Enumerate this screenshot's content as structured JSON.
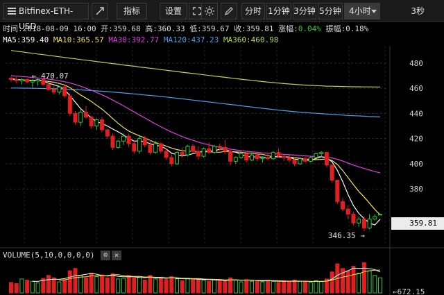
{
  "toolbar": {
    "symbol": "Bitfinex-ETH-USD",
    "indicators": "指标",
    "settings": "设置",
    "intervals": [
      "分时",
      "1分钟",
      "3分钟",
      "5分钟",
      "4小时"
    ],
    "active_interval": "4小时",
    "refresh": "3秒"
  },
  "info": {
    "time": "时间:2018-08-09 16:00",
    "open": "开:359.68",
    "high": "高:360.33",
    "low": "低:359.67",
    "close": "收:359.81",
    "change_label": "涨幅:",
    "change_value": "0.04%",
    "amplitude": "振幅:0.18%"
  },
  "ma": {
    "ma5": "MA5:359.40",
    "ma10": "MA10:365.57",
    "ma30": "MA30:392.77",
    "ma120": "MA120:437.23",
    "ma360": "MA360:460.98"
  },
  "volume": {
    "label": "VOLUME(5,10,0,0,0,0)",
    "last_label": "672.15"
  },
  "colors": {
    "up": "#32c832",
    "down": "#e02020",
    "ma5": "#ffffff",
    "ma10": "#f5e05a",
    "ma30": "#e040e0",
    "ma120": "#4aa0e8",
    "ma360": "#b8d85a"
  },
  "chart_data": {
    "type": "candlestick",
    "ylim": [
      336,
      486
    ],
    "yticks": [
      380,
      400,
      420,
      440,
      460,
      480
    ],
    "annotations": {
      "high": "470.07",
      "low": "346.35"
    },
    "last_price": "359.81",
    "candles": [
      [
        468,
        469.5,
        465,
        467
      ],
      [
        467,
        470.07,
        464,
        466
      ],
      [
        466,
        468,
        463,
        467
      ],
      [
        467,
        468,
        464,
        465
      ],
      [
        465,
        467,
        461,
        466
      ],
      [
        466,
        468,
        462,
        467
      ],
      [
        467,
        468,
        462,
        463
      ],
      [
        463,
        465,
        458,
        459
      ],
      [
        459,
        462,
        455,
        457
      ],
      [
        457,
        462,
        455,
        461
      ],
      [
        461,
        462,
        452,
        454
      ],
      [
        454,
        456,
        438,
        440
      ],
      [
        440,
        442,
        431,
        433
      ],
      [
        433,
        443,
        430,
        441
      ],
      [
        441,
        446,
        436,
        437
      ],
      [
        437,
        438,
        428,
        430
      ],
      [
        430,
        436,
        427,
        435
      ],
      [
        435,
        437,
        425,
        427
      ],
      [
        427,
        428,
        420,
        422
      ],
      [
        422,
        424,
        411,
        413
      ],
      [
        413,
        419,
        412,
        418
      ],
      [
        418,
        424,
        415,
        422
      ],
      [
        422,
        424,
        413,
        416
      ],
      [
        416,
        418,
        408,
        410
      ],
      [
        410,
        422,
        408,
        420
      ],
      [
        420,
        422,
        413,
        415
      ],
      [
        415,
        419,
        407,
        409
      ],
      [
        409,
        418,
        408,
        416
      ],
      [
        416,
        417,
        408,
        410
      ],
      [
        410,
        412,
        403,
        405
      ],
      [
        405,
        408,
        398,
        400
      ],
      [
        400,
        410,
        399,
        409
      ],
      [
        409,
        413,
        405,
        407
      ],
      [
        407,
        415,
        406,
        414
      ],
      [
        414,
        416,
        408,
        410
      ],
      [
        410,
        414,
        403,
        406
      ],
      [
        406,
        413,
        405,
        412
      ],
      [
        412,
        417,
        408,
        409
      ],
      [
        409,
        415,
        408,
        414
      ],
      [
        414,
        416,
        410,
        413
      ],
      [
        413,
        419,
        408,
        410
      ],
      [
        410,
        412,
        399,
        402
      ],
      [
        402,
        406,
        400,
        405
      ],
      [
        405,
        410,
        404,
        408
      ],
      [
        408,
        410,
        401,
        403
      ],
      [
        403,
        409,
        402,
        407
      ],
      [
        407,
        409,
        402,
        404
      ],
      [
        404,
        406,
        401,
        405
      ],
      [
        405,
        408,
        403,
        404
      ],
      [
        404,
        410,
        403,
        409
      ],
      [
        409,
        412,
        405,
        406
      ],
      [
        406,
        408,
        402,
        405
      ],
      [
        405,
        407,
        401,
        403
      ],
      [
        403,
        405,
        398,
        400
      ],
      [
        400,
        405,
        399,
        404
      ],
      [
        404,
        407,
        401,
        402
      ],
      [
        402,
        406,
        401,
        405
      ],
      [
        405,
        409,
        404,
        408
      ],
      [
        408,
        410,
        405,
        409
      ],
      [
        409,
        409,
        397,
        399
      ],
      [
        399,
        398.5,
        385,
        387
      ],
      [
        387,
        387,
        368,
        370
      ],
      [
        370,
        373,
        362,
        364
      ],
      [
        364,
        367,
        356,
        360
      ],
      [
        360,
        362,
        351,
        353
      ],
      [
        353,
        358,
        350,
        356
      ],
      [
        356,
        358,
        346.35,
        349
      ],
      [
        349,
        360,
        348,
        356
      ],
      [
        356,
        360,
        355,
        358
      ],
      [
        359.68,
        360.33,
        359.67,
        359.81
      ]
    ],
    "volume": [
      180,
      160,
      240,
      220,
      200,
      170,
      250,
      300,
      260,
      190,
      230,
      380,
      420,
      300,
      260,
      340,
      280,
      310,
      260,
      330,
      240,
      250,
      300,
      260,
      280,
      220,
      300,
      240,
      260,
      230,
      280,
      240,
      210,
      250,
      230,
      240,
      220,
      200,
      230,
      210,
      200,
      260,
      220,
      190,
      230,
      200,
      210,
      190,
      220,
      200,
      180,
      210,
      190,
      220,
      200,
      190,
      180,
      210,
      200,
      240,
      360,
      500,
      420,
      380,
      460,
      340,
      520,
      380,
      300,
      260
    ],
    "ma5_series": [
      467.6,
      467.0,
      466.6,
      466.2,
      466.2,
      466.2,
      465.6,
      464.0,
      462.8,
      461.4,
      458.8,
      454.2,
      449.0,
      443.8,
      440.0,
      436.6,
      433.4,
      432.0,
      430.0,
      427.6,
      425.4,
      423.0,
      420.0,
      418.0,
      418.2,
      417.4,
      416.0,
      414.6,
      414.0,
      411.8,
      408.4,
      407.2,
      406.2,
      407.0,
      408.0,
      409.2,
      409.8,
      410.2,
      410.2,
      411.6,
      411.6,
      409.8,
      409.2,
      407.6,
      405.6,
      405.6,
      405.4,
      405.4,
      404.6,
      405.8,
      405.6,
      405.6,
      405.4,
      403.6,
      403.4,
      402.8,
      402.8,
      404.2,
      405.6,
      404.6,
      401.6,
      394.8,
      385.8,
      375.6,
      366.8,
      360.6,
      356.4,
      352.8,
      351.4,
      356.0
    ],
    "ma10_series": [
      467.0,
      466.8,
      466.6,
      466.4,
      466.4,
      466.3,
      466.0,
      465.4,
      464.8,
      463.8,
      462.6,
      460.5,
      457.6,
      454.6,
      452.2,
      449.5,
      446.4,
      443.4,
      439.8,
      435.9,
      432.2,
      428.8,
      426.0,
      424.0,
      422.2,
      420.5,
      418.6,
      416.8,
      415.6,
      414.0,
      412.5,
      411.3,
      410.4,
      410.0,
      410.0,
      409.7,
      409.5,
      409.5,
      409.2,
      409.2,
      409.8,
      409.5,
      409.4,
      409.2,
      408.6,
      408.4,
      407.8,
      407.5,
      406.4,
      405.6,
      405.5,
      405.4,
      405.3,
      404.9,
      404.3,
      403.8,
      403.5,
      403.3,
      403.5,
      403.8,
      402.6,
      399.4,
      394.6,
      389.0,
      383.4,
      378.0,
      373.6,
      368.7,
      363.7,
      359.5
    ],
    "ma30_series": [
      470,
      469.6,
      469.3,
      469.0,
      468.6,
      468.2,
      467.8,
      467.3,
      466.7,
      466.0,
      465.2,
      464.2,
      463.0,
      461.6,
      460.0,
      458.4,
      456.6,
      454.8,
      452.8,
      450.6,
      448.4,
      446.0,
      443.6,
      441.2,
      438.8,
      436.4,
      434.0,
      431.6,
      429.4,
      427.2,
      425.2,
      423.4,
      421.6,
      420.0,
      418.6,
      417.2,
      416.0,
      415.0,
      414.0,
      413.1,
      412.3,
      411.6,
      411.0,
      410.4,
      409.9,
      409.5,
      409.1,
      408.7,
      408.4,
      408.1,
      407.8,
      407.5,
      407.2,
      406.9,
      406.6,
      406.3,
      406.0,
      405.8,
      405.6,
      405.3,
      404.6,
      403.6,
      402.2,
      400.6,
      399.0,
      397.6,
      396.3,
      395.0,
      393.8,
      392.77
    ],
    "ma120_series": [
      460.2,
      460.2,
      460.1,
      460.1,
      460.0,
      459.9,
      459.8,
      459.7,
      459.6,
      459.4,
      459.3,
      459.1,
      458.9,
      458.7,
      458.4,
      458.2,
      457.9,
      457.6,
      457.3,
      457.0,
      456.6,
      456.3,
      455.9,
      455.5,
      455.1,
      454.7,
      454.3,
      453.9,
      453.4,
      453.0,
      452.5,
      452.1,
      451.6,
      451.1,
      450.6,
      450.1,
      449.6,
      449.1,
      448.6,
      448.1,
      447.6,
      447.1,
      446.6,
      446.1,
      445.6,
      445.1,
      444.6,
      444.1,
      443.6,
      443.1,
      442.6,
      442.2,
      441.8,
      441.4,
      441.0,
      440.7,
      440.4,
      440.1,
      439.8,
      439.5,
      439.2,
      438.9,
      438.7,
      438.4,
      438.2,
      438.0,
      437.8,
      437.6,
      437.4,
      437.23
    ],
    "ma360_series": [
      490,
      489.4,
      488.9,
      488.3,
      487.8,
      487.2,
      486.7,
      486.1,
      485.6,
      485.0,
      484.5,
      483.9,
      483.4,
      482.8,
      482.3,
      481.8,
      481.2,
      480.7,
      480.1,
      479.6,
      479.1,
      478.5,
      478.0,
      477.5,
      476.9,
      476.4,
      475.9,
      475.4,
      474.8,
      474.3,
      473.8,
      473.3,
      472.7,
      472.2,
      471.7,
      471.2,
      470.7,
      470.2,
      469.7,
      469.2,
      468.7,
      468.2,
      467.7,
      467.2,
      466.7,
      466.3,
      465.8,
      465.3,
      464.9,
      464.5,
      464.1,
      463.7,
      463.4,
      463.1,
      462.8,
      462.5,
      462.3,
      462.1,
      461.9,
      461.7,
      461.6,
      461.5,
      461.4,
      461.3,
      461.2,
      461.15,
      461.1,
      461.05,
      461.0,
      460.98
    ]
  }
}
